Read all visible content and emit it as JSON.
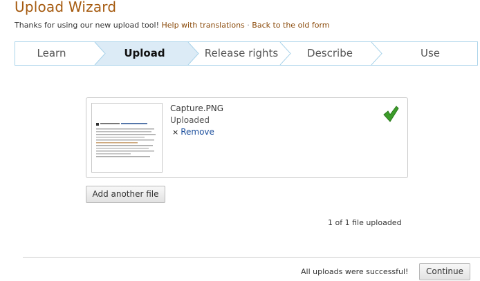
{
  "header": {
    "title": "Upload Wizard",
    "thanks_text": "Thanks for using our new upload tool!",
    "help_link": "Help with translations",
    "separator": "·",
    "old_form_link": "Back to the old form"
  },
  "steps": [
    {
      "label": "Learn",
      "active": false
    },
    {
      "label": "Upload",
      "active": true
    },
    {
      "label": "Release rights",
      "active": false
    },
    {
      "label": "Describe",
      "active": false
    },
    {
      "label": "Use",
      "active": false
    }
  ],
  "upload": {
    "file_name": "Capture.PNG",
    "status": "Uploaded",
    "remove_label": "Remove",
    "remove_icon": "×"
  },
  "add_file_label": "Add another file",
  "count_text": "1 of 1 file uploaded",
  "footer": {
    "success_text": "All uploads were successful!",
    "continue_label": "Continue"
  },
  "colors": {
    "title": "#a55a0f",
    "link": "#8a4a0a",
    "active_step_bg": "#dcebf6",
    "step_border": "#a9d3ea",
    "check": "#3c9c2a",
    "remove_link": "#1a4d9c"
  }
}
